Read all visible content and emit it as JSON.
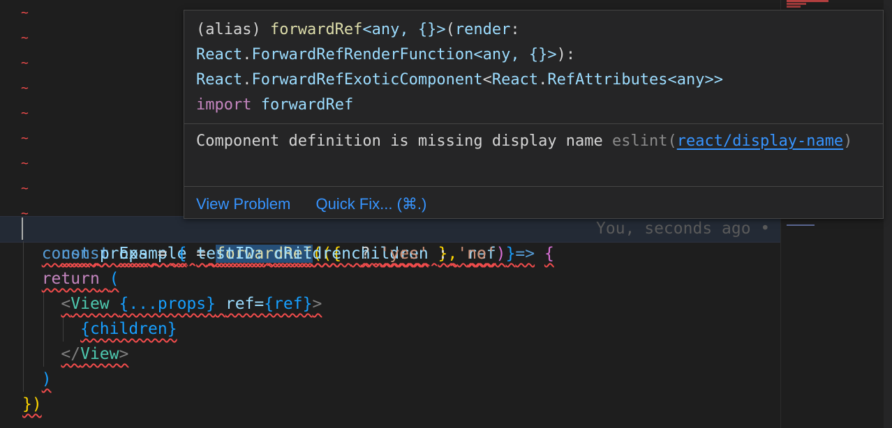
{
  "editor": {
    "lines": {
      "l1": {
        "kw": "const",
        "name": "Example",
        "eq": "=",
        "fn": "forwardRef",
        "p1": "(({",
        "children": "children",
        "p2": "},",
        "ref": "ref",
        "p3": ")",
        "arrow": "=>",
        "brace": "{"
      },
      "l2": {
        "kw": "const",
        "name": "props",
        "eq": "=",
        "o": "{",
        "key": "testID:",
        "children": "children",
        "q": "?",
        "yes": "'yes'",
        "colon": ":",
        "no": "'no'",
        "c": "}"
      },
      "l3": {
        "kw": "return",
        "paren": "("
      },
      "l4": {
        "open": "<",
        "tag": "View",
        "spread": "{...props}",
        "attr": "ref=",
        "refexpr": "{ref}",
        "close": ">"
      },
      "l5": {
        "expr": "{children}"
      },
      "l6": {
        "open": "</",
        "tag": "View",
        "close": ">"
      },
      "l7": {
        "paren": ")"
      },
      "l8": {
        "end": "})"
      }
    },
    "blame": "You, seconds ago •"
  },
  "hover": {
    "sig": {
      "alias": "(alias) ",
      "fn": "forwardRef",
      "gen": "<any, {}>",
      "open": "(",
      "param": "render",
      "colon": ":",
      "react1": "React",
      "dot1": ".",
      "type1": "ForwardRefRenderFunction",
      "gen2": "<any, {}>",
      "close": "):",
      "react2": "React",
      "dot2": ".",
      "type2": "ForwardRefExoticComponent",
      "lt": "<",
      "react3": "React",
      "dot3": ".",
      "type3": "RefAttributes",
      "gen3": "<any>>",
      "import": "import",
      "name": "forwardRef"
    },
    "message": "Component definition is missing display name",
    "source": "eslint(",
    "rule": "react/display-name",
    "source_close": ")",
    "actions": {
      "view_problem": "View Problem",
      "quick_fix": "Quick Fix... (⌘.)"
    }
  },
  "colors": {
    "error": "#f14c4c",
    "link": "#3794ff",
    "hover_bg": "#252526"
  }
}
